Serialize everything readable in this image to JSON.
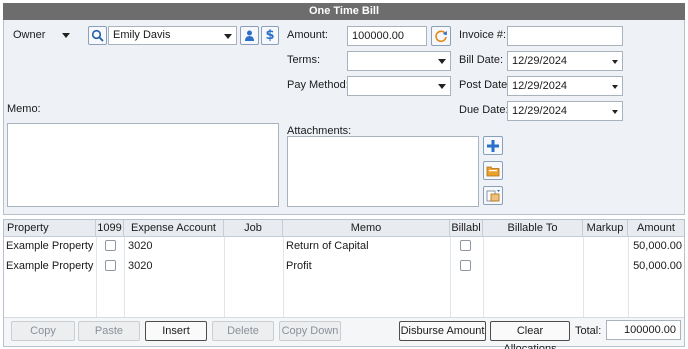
{
  "window": {
    "title": "One Time Bill"
  },
  "owner": {
    "type_label": "Owner",
    "name": "Emily Davis"
  },
  "amount": {
    "label": "Amount:",
    "value": "100000.00"
  },
  "terms": {
    "label": "Terms:",
    "value": ""
  },
  "pay_method": {
    "label": "Pay Method:",
    "value": ""
  },
  "invoice": {
    "label": "Invoice #:",
    "value": ""
  },
  "bill_date": {
    "label": "Bill Date:",
    "value": "12/29/2024"
  },
  "post_date": {
    "label": "Post Date:",
    "value": "12/29/2024"
  },
  "due_date": {
    "label": "Due Date:",
    "value": "12/29/2024"
  },
  "memo": {
    "label": "Memo:",
    "value": ""
  },
  "attachments": {
    "label": "Attachments:"
  },
  "grid": {
    "columns": [
      "Property",
      "1099",
      "Expense Account",
      "Job",
      "Memo",
      "Billabl",
      "Billable To",
      "Markup",
      "Amount"
    ],
    "rows": [
      {
        "property": "Example Property",
        "is1099": false,
        "expense_account": "3020",
        "job": "",
        "memo": "Return of Capital",
        "billable": false,
        "billable_to": "",
        "markup": "",
        "amount": "50,000.00"
      },
      {
        "property": "Example Property",
        "is1099": false,
        "expense_account": "3020",
        "job": "",
        "memo": "Profit",
        "billable": false,
        "billable_to": "",
        "markup": "",
        "amount": "50,000.00"
      }
    ]
  },
  "footer": {
    "copy": "Copy",
    "paste": "Paste",
    "insert": "Insert",
    "delete": "Delete",
    "copy_down": "Copy Down",
    "disburse": "Disburse Amount",
    "clear": "Clear Allocations",
    "total_label": "Total:",
    "total_value": "100000.00"
  },
  "colors": {
    "accent": "#2a6fc9",
    "title_bar": "#6d6d6d",
    "panel": "#eef2f7"
  },
  "icons": [
    "search-icon",
    "owner-person-icon",
    "dollar-icon",
    "refresh-icon",
    "add-icon",
    "folder-icon",
    "scan-icon"
  ]
}
